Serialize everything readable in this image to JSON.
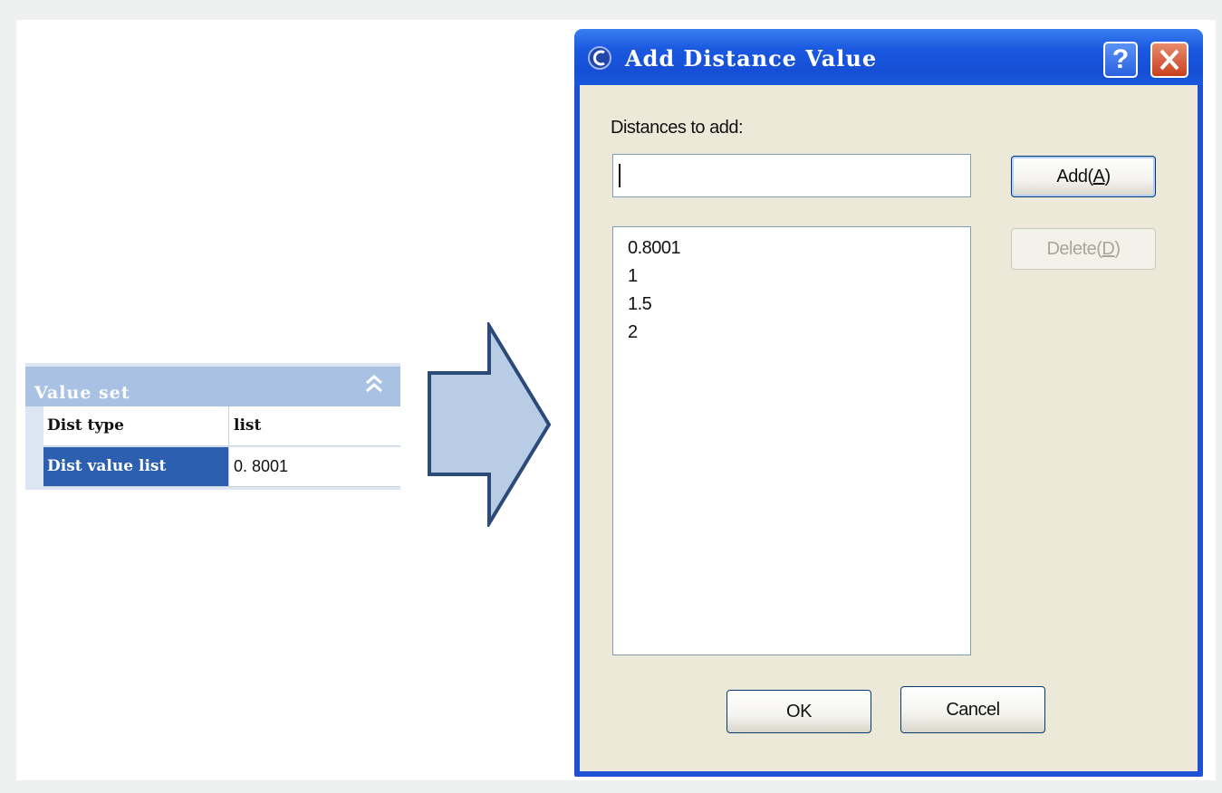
{
  "property_panel": {
    "title": "Value set",
    "rows": [
      {
        "name": "Dist type",
        "value": "list"
      },
      {
        "name": "Dist value list",
        "value": "0. 8001"
      }
    ]
  },
  "dialog": {
    "title": "Add Distance Value",
    "help_label": "?",
    "distances_label": "Distances to add:",
    "input_value": "",
    "add_button": {
      "text": "Add(",
      "mnemonic": "A",
      "suffix": ")"
    },
    "delete_button": {
      "text": "Delete(",
      "mnemonic": "D",
      "suffix": ")"
    },
    "list_items": [
      "0.8001",
      "1",
      "1.5",
      "2"
    ],
    "ok_label": "OK",
    "cancel_label": "Cancel"
  },
  "colors": {
    "titlebar": "#1b59e0",
    "dialog_body": "#ece9d8",
    "selection": "#2c5faf",
    "panel_header": "#a9c2e4",
    "arrow_fill": "#b9cce6",
    "arrow_stroke": "#2b4a78"
  },
  "icons": [
    "collapse-chevrons-icon",
    "app-icon",
    "help-icon",
    "close-icon",
    "right-arrow-icon"
  ]
}
